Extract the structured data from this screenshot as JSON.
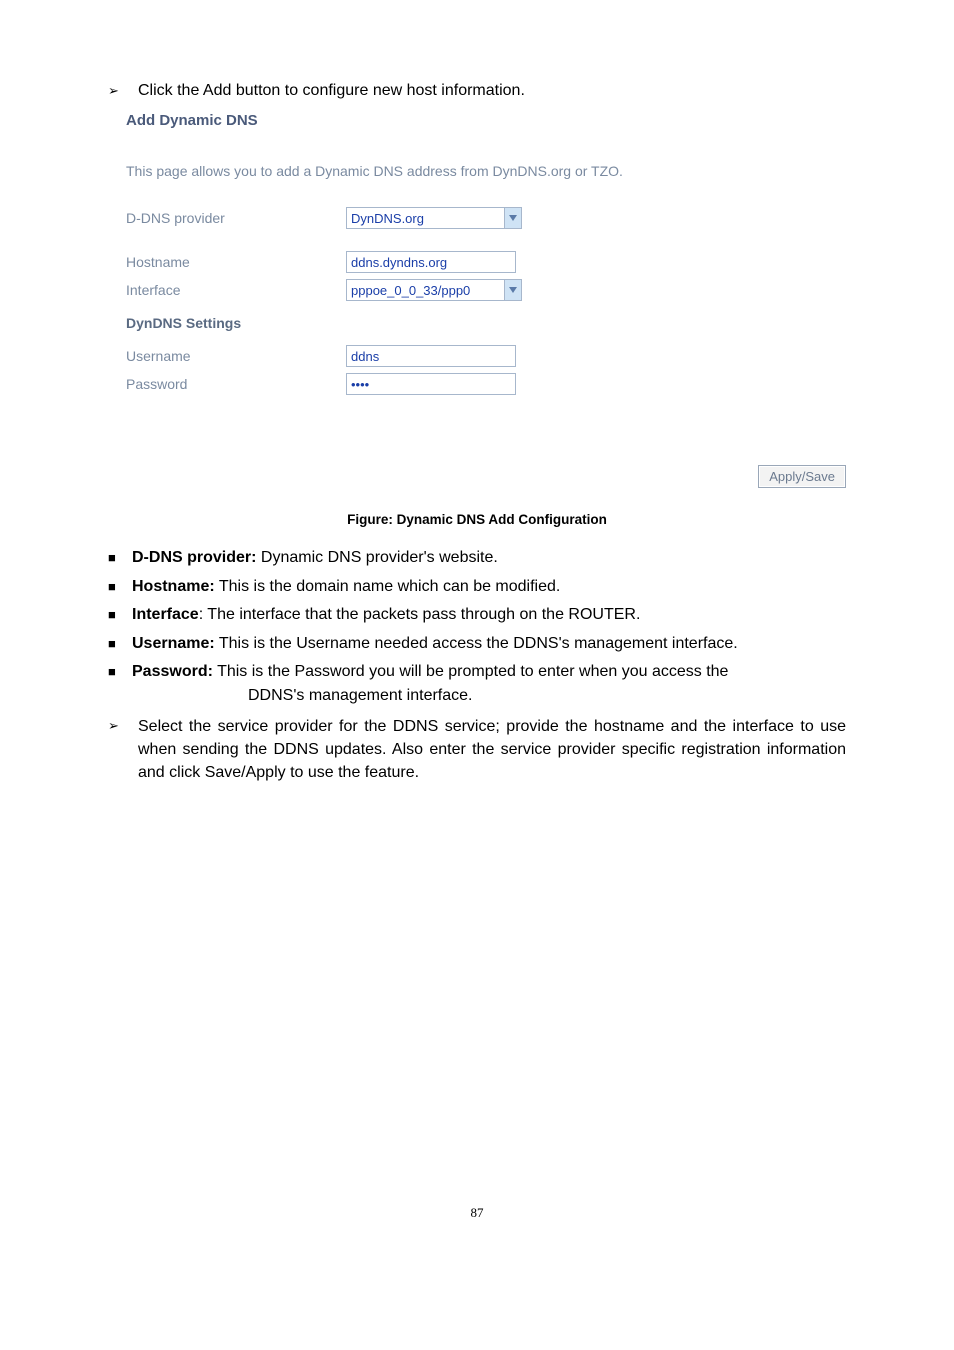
{
  "intro": {
    "click_add": "Click the Add button to configure new host information."
  },
  "panel": {
    "title": "Add Dynamic DNS",
    "desc": "This page allows you to add a Dynamic DNS address from DynDNS.org or TZO.",
    "labels": {
      "provider": "D-DNS provider",
      "hostname": "Hostname",
      "interface": "Interface",
      "section_dyndns": "DynDNS Settings",
      "username": "Username",
      "password": "Password"
    },
    "values": {
      "provider": "DynDNS.org",
      "hostname": "ddns.dyndns.org",
      "interface": "pppoe_0_0_33/ppp0",
      "username": "ddns",
      "password": "••••"
    },
    "apply_label": "Apply/Save"
  },
  "figure_caption": "Figure: Dynamic DNS Add Configuration",
  "defs": {
    "provider": {
      "label": "D-DNS provider:",
      "text": " Dynamic DNS provider's website."
    },
    "hostname": {
      "label": "Hostname:",
      "text": " This is the domain name which can be modified."
    },
    "interface": {
      "label": "Interface",
      "text": ": The interface that the packets pass through on the ROUTER."
    },
    "username": {
      "label": "Username:",
      "text": " This is the Username needed access the DDNS's management interface."
    },
    "password": {
      "label": "Password:",
      "text": " This is the Password you will be prompted to enter when you access the",
      "text2": "DDNS's management interface."
    }
  },
  "final": "Select the service provider for the DDNS service; provide the hostname and the interface to use when sending the DDNS updates. Also enter the service provider specific registration information and click Save/Apply to use the feature.",
  "page_number": "87"
}
